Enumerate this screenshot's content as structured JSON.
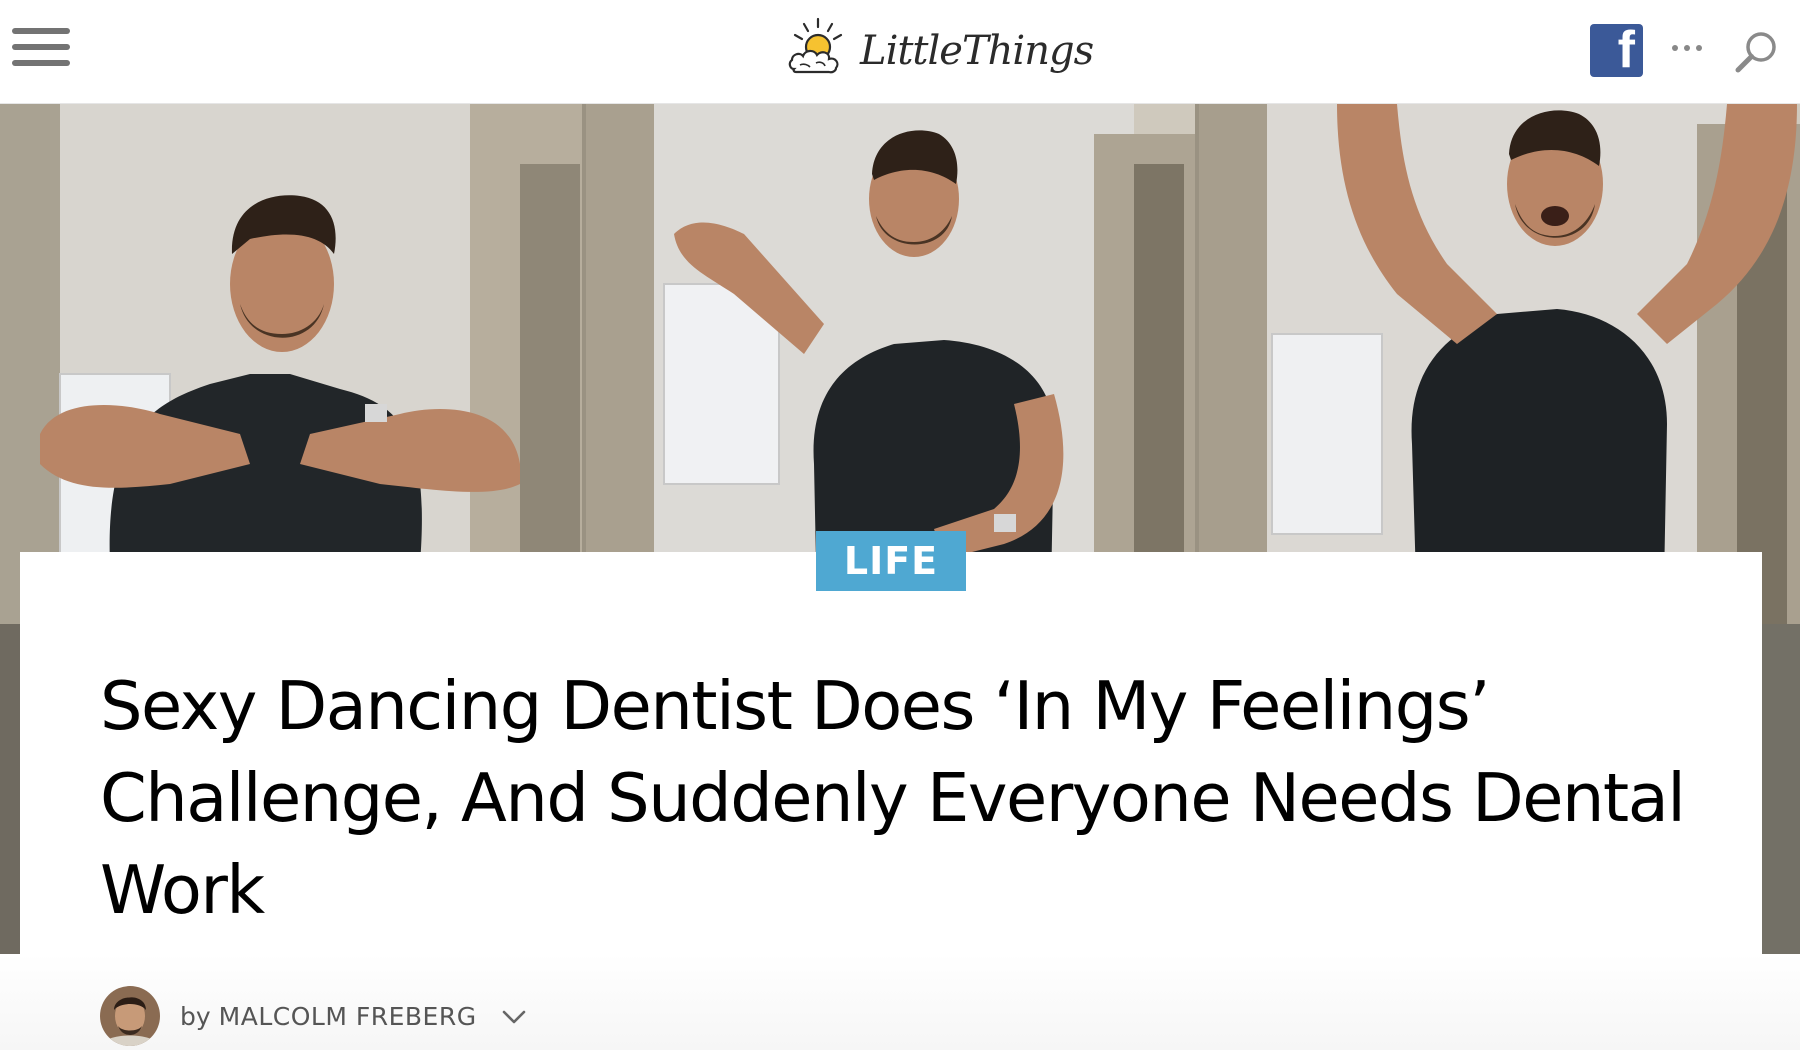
{
  "header": {
    "logo_text": "LittleThings",
    "facebook_icon_glyph": "f",
    "icons": [
      "hamburger-menu-icon",
      "sun-cloud-logo-icon",
      "facebook-icon",
      "more-options-icon",
      "search-icon"
    ]
  },
  "article": {
    "category": "LIFE",
    "headline": "Sexy Dancing Dentist Does ‘In My Feelings’ Challenge, And Suddenly Everyone Needs Dental Work",
    "byline_prefix": "by",
    "author": "MALCOLM FREBERG"
  },
  "colors": {
    "category_badge": "#4fa8d2",
    "facebook": "#3b5998",
    "headline": "#000000",
    "scrubs": "#1f2326"
  }
}
